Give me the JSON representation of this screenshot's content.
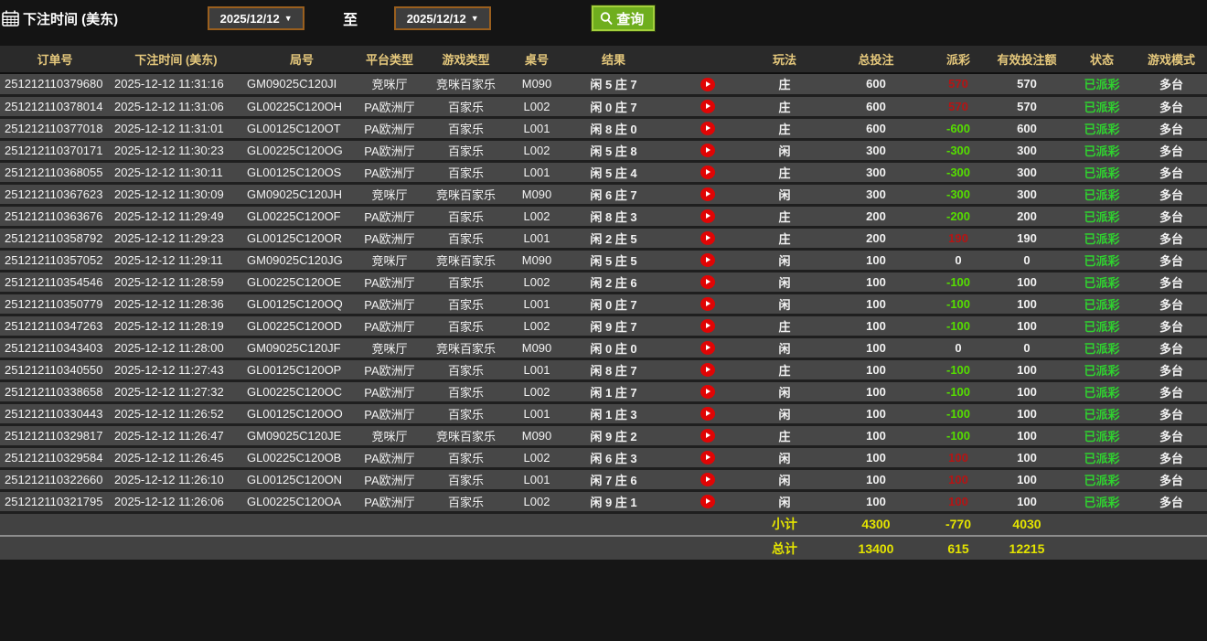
{
  "filter": {
    "label": "下注时间 (美东)",
    "date_from": "2025/12/12",
    "to_label": "至",
    "date_to": "2025/12/12",
    "query_label": "查询"
  },
  "icons": {
    "calendar": "calendar-icon",
    "search": "search-icon",
    "dropdown": "▼",
    "play": "replay-play-icon"
  },
  "colors": {
    "header_text": "#e5c87c",
    "row_bg": "#474747",
    "payout_positive": "#b51414",
    "payout_negative": "#55dd00",
    "status_green": "#2fd32f",
    "footer_yellow": "#e4e400",
    "query_button_green": "#6fae1e",
    "date_border_orange": "#9a5f1e"
  },
  "table": {
    "headers": [
      "订单号",
      "下注时间 (美东)",
      "局号",
      "平台类型",
      "游戏类型",
      "桌号",
      "结果",
      "",
      "玩法",
      "总投注",
      "派彩",
      "有效投注额",
      "状态",
      "游戏模式"
    ],
    "rows": [
      {
        "order": "251212110379680",
        "time": "2025-12-12 11:31:16",
        "round": "GM09025C120JI",
        "platform": "竞咪厅",
        "game": "竞咪百家乐",
        "table_no": "M090",
        "result": "闲 5 庄 7",
        "play": "庄",
        "total_bet": "600",
        "payout": "570",
        "payout_color": "red",
        "valid_bet": "570",
        "status": "已派彩",
        "mode": "多台"
      },
      {
        "order": "251212110378014",
        "time": "2025-12-12 11:31:06",
        "round": "GL00225C120OH",
        "platform": "PA欧洲厅",
        "game": "百家乐",
        "table_no": "L002",
        "result": "闲 0 庄 7",
        "play": "庄",
        "total_bet": "600",
        "payout": "570",
        "payout_color": "red",
        "valid_bet": "570",
        "status": "已派彩",
        "mode": "多台"
      },
      {
        "order": "251212110377018",
        "time": "2025-12-12 11:31:01",
        "round": "GL00125C120OT",
        "platform": "PA欧洲厅",
        "game": "百家乐",
        "table_no": "L001",
        "result": "闲 8 庄 0",
        "play": "庄",
        "total_bet": "600",
        "payout": "-600",
        "payout_color": "green",
        "valid_bet": "600",
        "status": "已派彩",
        "mode": "多台"
      },
      {
        "order": "251212110370171",
        "time": "2025-12-12 11:30:23",
        "round": "GL00225C120OG",
        "platform": "PA欧洲厅",
        "game": "百家乐",
        "table_no": "L002",
        "result": "闲 5 庄 8",
        "play": "闲",
        "total_bet": "300",
        "payout": "-300",
        "payout_color": "green",
        "valid_bet": "300",
        "status": "已派彩",
        "mode": "多台"
      },
      {
        "order": "251212110368055",
        "time": "2025-12-12 11:30:11",
        "round": "GL00125C120OS",
        "platform": "PA欧洲厅",
        "game": "百家乐",
        "table_no": "L001",
        "result": "闲 5 庄 4",
        "play": "庄",
        "total_bet": "300",
        "payout": "-300",
        "payout_color": "green",
        "valid_bet": "300",
        "status": "已派彩",
        "mode": "多台"
      },
      {
        "order": "251212110367623",
        "time": "2025-12-12 11:30:09",
        "round": "GM09025C120JH",
        "platform": "竞咪厅",
        "game": "竞咪百家乐",
        "table_no": "M090",
        "result": "闲 6 庄 7",
        "play": "闲",
        "total_bet": "300",
        "payout": "-300",
        "payout_color": "green",
        "valid_bet": "300",
        "status": "已派彩",
        "mode": "多台"
      },
      {
        "order": "251212110363676",
        "time": "2025-12-12 11:29:49",
        "round": "GL00225C120OF",
        "platform": "PA欧洲厅",
        "game": "百家乐",
        "table_no": "L002",
        "result": "闲 8 庄 3",
        "play": "庄",
        "total_bet": "200",
        "payout": "-200",
        "payout_color": "green",
        "valid_bet": "200",
        "status": "已派彩",
        "mode": "多台"
      },
      {
        "order": "251212110358792",
        "time": "2025-12-12 11:29:23",
        "round": "GL00125C120OR",
        "platform": "PA欧洲厅",
        "game": "百家乐",
        "table_no": "L001",
        "result": "闲 2 庄 5",
        "play": "庄",
        "total_bet": "200",
        "payout": "190",
        "payout_color": "red",
        "valid_bet": "190",
        "status": "已派彩",
        "mode": "多台"
      },
      {
        "order": "251212110357052",
        "time": "2025-12-12 11:29:11",
        "round": "GM09025C120JG",
        "platform": "竞咪厅",
        "game": "竞咪百家乐",
        "table_no": "M090",
        "result": "闲 5 庄 5",
        "play": "闲",
        "total_bet": "100",
        "payout": "0",
        "payout_color": "white",
        "valid_bet": "0",
        "status": "已派彩",
        "mode": "多台"
      },
      {
        "order": "251212110354546",
        "time": "2025-12-12 11:28:59",
        "round": "GL00225C120OE",
        "platform": "PA欧洲厅",
        "game": "百家乐",
        "table_no": "L002",
        "result": "闲 2 庄 6",
        "play": "闲",
        "total_bet": "100",
        "payout": "-100",
        "payout_color": "green",
        "valid_bet": "100",
        "status": "已派彩",
        "mode": "多台"
      },
      {
        "order": "251212110350779",
        "time": "2025-12-12 11:28:36",
        "round": "GL00125C120OQ",
        "platform": "PA欧洲厅",
        "game": "百家乐",
        "table_no": "L001",
        "result": "闲 0 庄 7",
        "play": "闲",
        "total_bet": "100",
        "payout": "-100",
        "payout_color": "green",
        "valid_bet": "100",
        "status": "已派彩",
        "mode": "多台"
      },
      {
        "order": "251212110347263",
        "time": "2025-12-12 11:28:19",
        "round": "GL00225C120OD",
        "platform": "PA欧洲厅",
        "game": "百家乐",
        "table_no": "L002",
        "result": "闲 9 庄 7",
        "play": "庄",
        "total_bet": "100",
        "payout": "-100",
        "payout_color": "green",
        "valid_bet": "100",
        "status": "已派彩",
        "mode": "多台"
      },
      {
        "order": "251212110343403",
        "time": "2025-12-12 11:28:00",
        "round": "GM09025C120JF",
        "platform": "竞咪厅",
        "game": "竞咪百家乐",
        "table_no": "M090",
        "result": "闲 0 庄 0",
        "play": "闲",
        "total_bet": "100",
        "payout": "0",
        "payout_color": "white",
        "valid_bet": "0",
        "status": "已派彩",
        "mode": "多台"
      },
      {
        "order": "251212110340550",
        "time": "2025-12-12 11:27:43",
        "round": "GL00125C120OP",
        "platform": "PA欧洲厅",
        "game": "百家乐",
        "table_no": "L001",
        "result": "闲 8 庄 7",
        "play": "庄",
        "total_bet": "100",
        "payout": "-100",
        "payout_color": "green",
        "valid_bet": "100",
        "status": "已派彩",
        "mode": "多台"
      },
      {
        "order": "251212110338658",
        "time": "2025-12-12 11:27:32",
        "round": "GL00225C120OC",
        "platform": "PA欧洲厅",
        "game": "百家乐",
        "table_no": "L002",
        "result": "闲 1 庄 7",
        "play": "闲",
        "total_bet": "100",
        "payout": "-100",
        "payout_color": "green",
        "valid_bet": "100",
        "status": "已派彩",
        "mode": "多台"
      },
      {
        "order": "251212110330443",
        "time": "2025-12-12 11:26:52",
        "round": "GL00125C120OO",
        "platform": "PA欧洲厅",
        "game": "百家乐",
        "table_no": "L001",
        "result": "闲 1 庄 3",
        "play": "闲",
        "total_bet": "100",
        "payout": "-100",
        "payout_color": "green",
        "valid_bet": "100",
        "status": "已派彩",
        "mode": "多台"
      },
      {
        "order": "251212110329817",
        "time": "2025-12-12 11:26:47",
        "round": "GM09025C120JE",
        "platform": "竞咪厅",
        "game": "竞咪百家乐",
        "table_no": "M090",
        "result": "闲 9 庄 2",
        "play": "庄",
        "total_bet": "100",
        "payout": "-100",
        "payout_color": "green",
        "valid_bet": "100",
        "status": "已派彩",
        "mode": "多台"
      },
      {
        "order": "251212110329584",
        "time": "2025-12-12 11:26:45",
        "round": "GL00225C120OB",
        "platform": "PA欧洲厅",
        "game": "百家乐",
        "table_no": "L002",
        "result": "闲 6 庄 3",
        "play": "闲",
        "total_bet": "100",
        "payout": "100",
        "payout_color": "red",
        "valid_bet": "100",
        "status": "已派彩",
        "mode": "多台"
      },
      {
        "order": "251212110322660",
        "time": "2025-12-12 11:26:10",
        "round": "GL00125C120ON",
        "platform": "PA欧洲厅",
        "game": "百家乐",
        "table_no": "L001",
        "result": "闲 7 庄 6",
        "play": "闲",
        "total_bet": "100",
        "payout": "100",
        "payout_color": "red",
        "valid_bet": "100",
        "status": "已派彩",
        "mode": "多台"
      },
      {
        "order": "251212110321795",
        "time": "2025-12-12 11:26:06",
        "round": "GL00225C120OA",
        "platform": "PA欧洲厅",
        "game": "百家乐",
        "table_no": "L002",
        "result": "闲 9 庄 1",
        "play": "闲",
        "total_bet": "100",
        "payout": "100",
        "payout_color": "red",
        "valid_bet": "100",
        "status": "已派彩",
        "mode": "多台"
      }
    ],
    "footer": {
      "subtotal": {
        "label": "小计",
        "total_bet": "4300",
        "payout": "-770",
        "valid_bet": "4030"
      },
      "total": {
        "label": "总计",
        "total_bet": "13400",
        "payout": "615",
        "valid_bet": "12215"
      }
    }
  }
}
